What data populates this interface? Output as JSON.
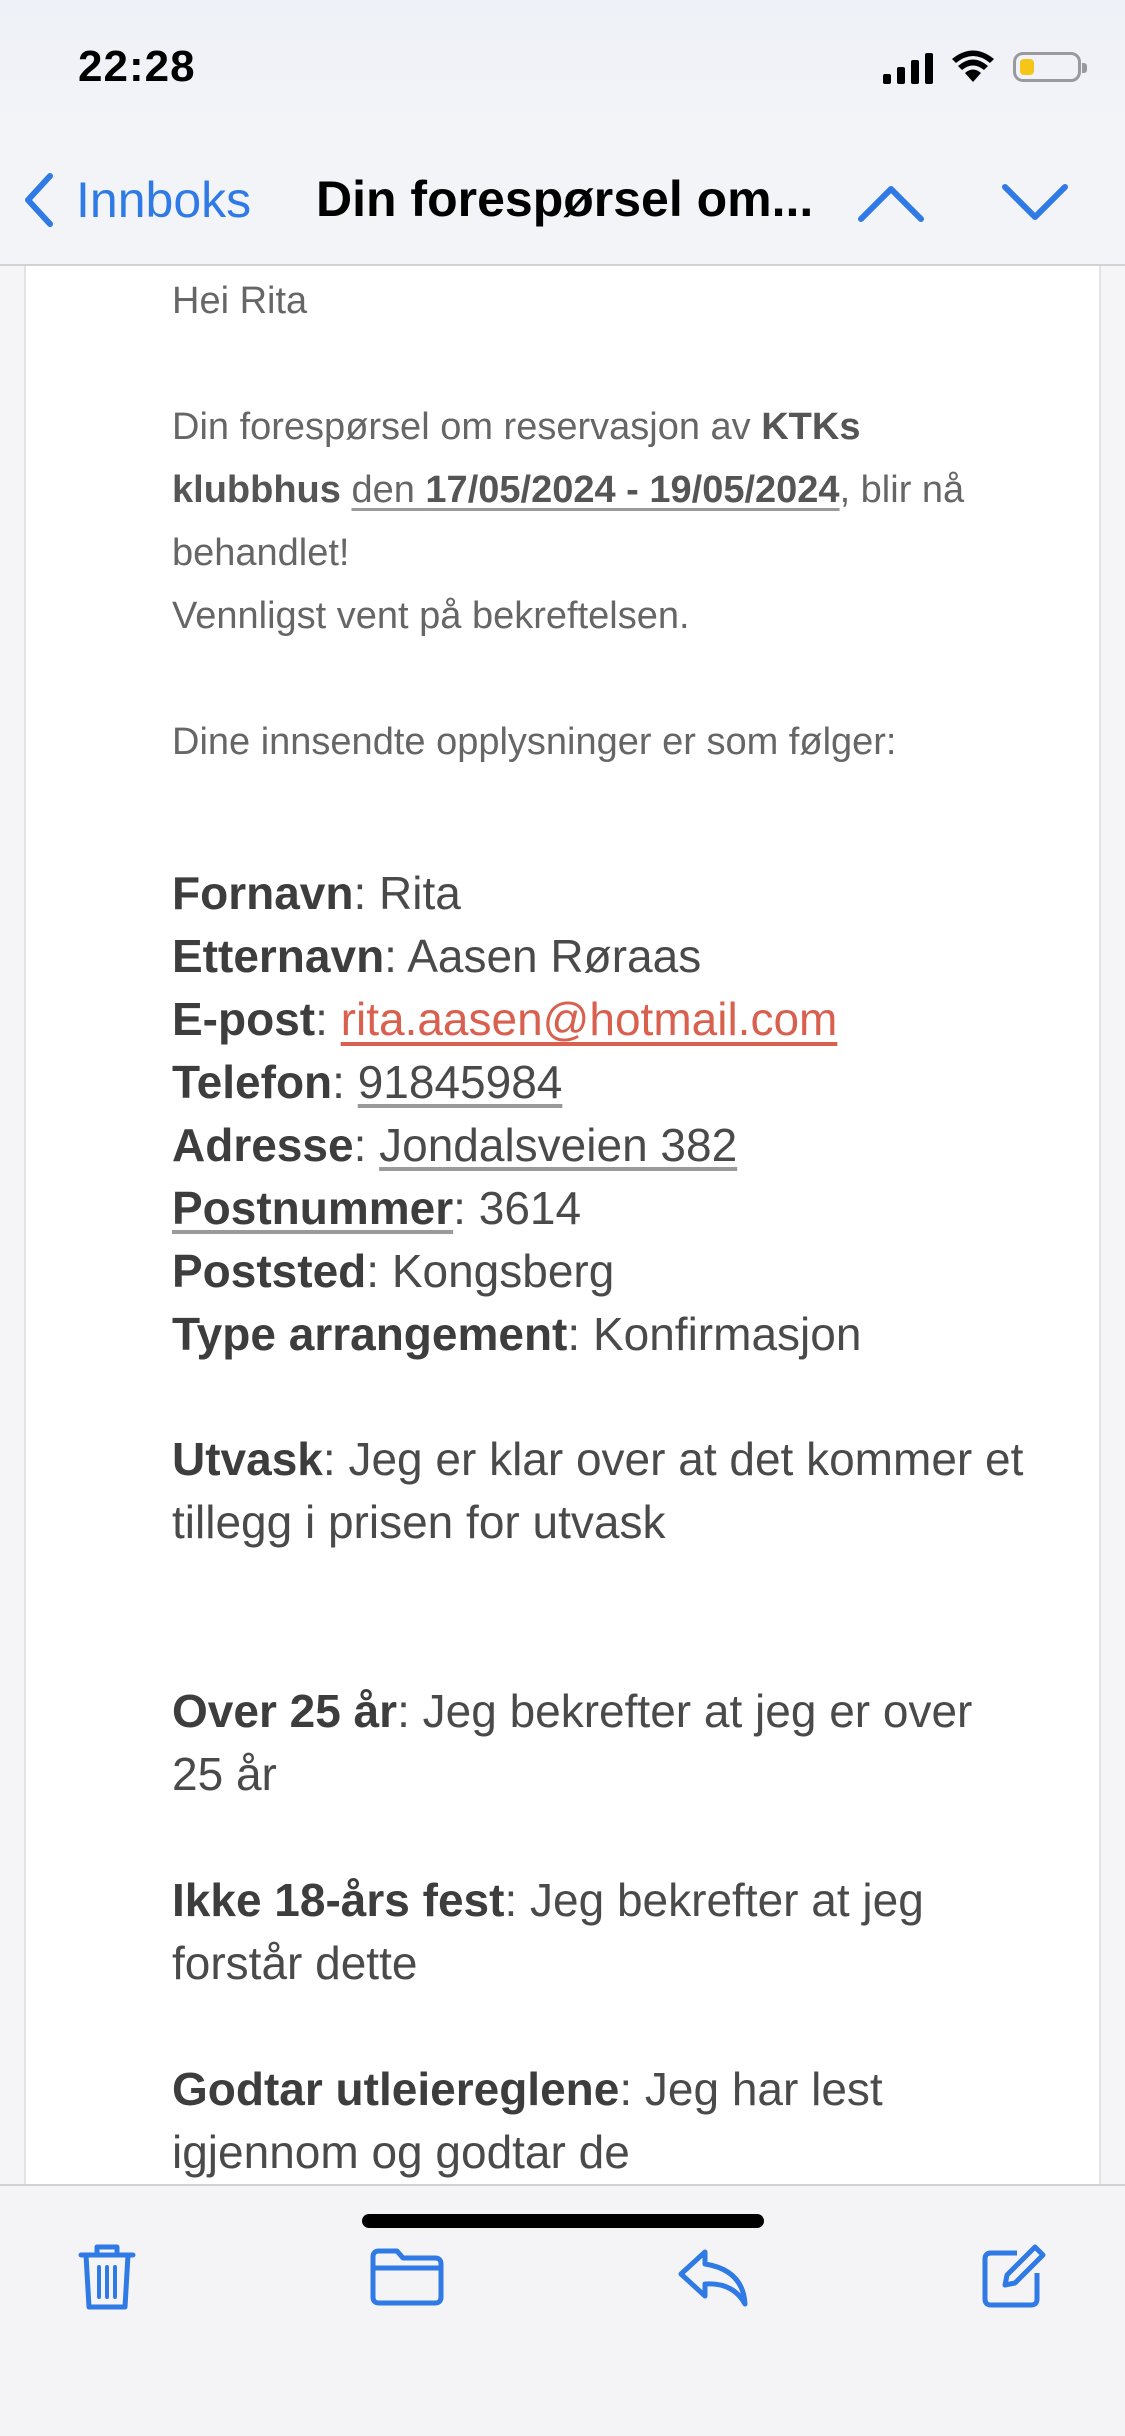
{
  "status_bar": {
    "time": "22:28",
    "battery_level": 0.25,
    "battery_color": "#f5c518"
  },
  "nav": {
    "back_label": "Innboks",
    "title": "Din forespørsel om...",
    "accent_color": "#2f7ae5",
    "icons": [
      "chevron-left-icon",
      "chevron-up-icon",
      "chevron-down-icon"
    ]
  },
  "email": {
    "greeting": "Hei Rita",
    "intro": {
      "prefix": "Din forespørsel om reservasjon av ",
      "venue": "KTKs klubbhus",
      "den": "den ",
      "dates": "17/05/2024 - 19/05/2024",
      "suffix": ", blir nå behandlet!",
      "line2": "Vennligst vent på bekreftelsen."
    },
    "submitted_intro": "Dine innsendte opplysninger er som følger:",
    "fields": {
      "fornavn": {
        "label": "Fornavn",
        "value": "Rita"
      },
      "etternavn": {
        "label": "Etternavn",
        "value": "Aasen Røraas"
      },
      "epost": {
        "label": "E-post",
        "value": "rita.aasen@hotmail.com"
      },
      "telefon": {
        "label": "Telefon",
        "value": "91845984"
      },
      "adresse": {
        "label": "Adresse",
        "value": "Jondalsveien 382"
      },
      "postnummer": {
        "label": "Postnummer",
        "value": "3614"
      },
      "poststed": {
        "label": "Poststed",
        "value": "Kongsberg"
      },
      "type": {
        "label": "Type arrangement",
        "value": "Konfirmasjon"
      }
    },
    "separator": ": ",
    "confirmations": {
      "utvask": {
        "label": "Utvask",
        "text": "Jeg er klar over at det kommer et tillegg i prisen for utvask"
      },
      "over25": {
        "label": "Over 25 år",
        "text": "Jeg bekrefter at jeg er over 25 år"
      },
      "ikke18": {
        "label": "Ikke 18-års fest",
        "text": "Jeg bekrefter at jeg forstår dette"
      },
      "godtar": {
        "label": "Godtar utleiereglene",
        "text": "Jeg har lest igjennom og godtar de"
      }
    },
    "link_color": "#d9604e"
  },
  "toolbar": {
    "items": [
      "trash-icon",
      "folder-icon",
      "reply-icon",
      "compose-icon"
    ]
  }
}
